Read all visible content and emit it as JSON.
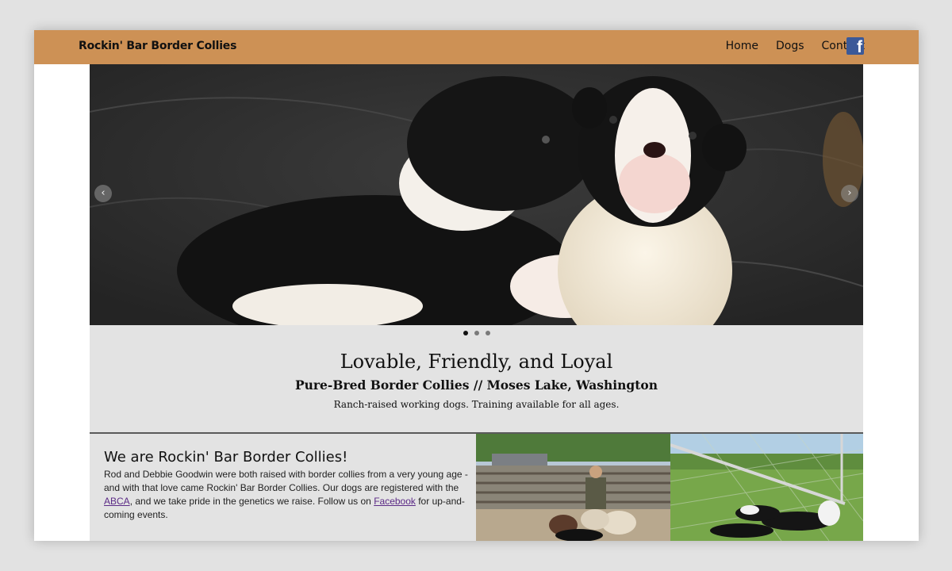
{
  "site": {
    "brand": "Rockin' Bar Border Collies",
    "nav": [
      "Home",
      "Dogs",
      "Contact"
    ],
    "facebook_icon": "facebook-icon"
  },
  "carousel": {
    "prev_label": "‹",
    "next_label": "›",
    "dot_count": 3,
    "active_dot": 0
  },
  "intro": {
    "title": "Lovable, Friendly, and Loyal",
    "subtitle": "Pure-Bred Border Collies // Moses Lake, Washington",
    "tagline": "Ranch-raised working dogs. Training available for all ages."
  },
  "about": {
    "heading": "We are Rockin' Bar Border Collies!",
    "text_1": "Rod and Debbie Goodwin were both raised with border collies from a very young age - and with that love came Rockin' Bar Border Collies. Our dogs are registered with the ",
    "link_abca": "ABCA",
    "text_2": ", and we take pride in the genetics we raise. Follow us on ",
    "link_facebook": "Facebook",
    "text_3": " for up-and-coming events."
  },
  "colors": {
    "topbar": "#cd9155",
    "panel": "#e3e3e3",
    "link": "#5b2a86",
    "facebook": "#3b5998"
  }
}
